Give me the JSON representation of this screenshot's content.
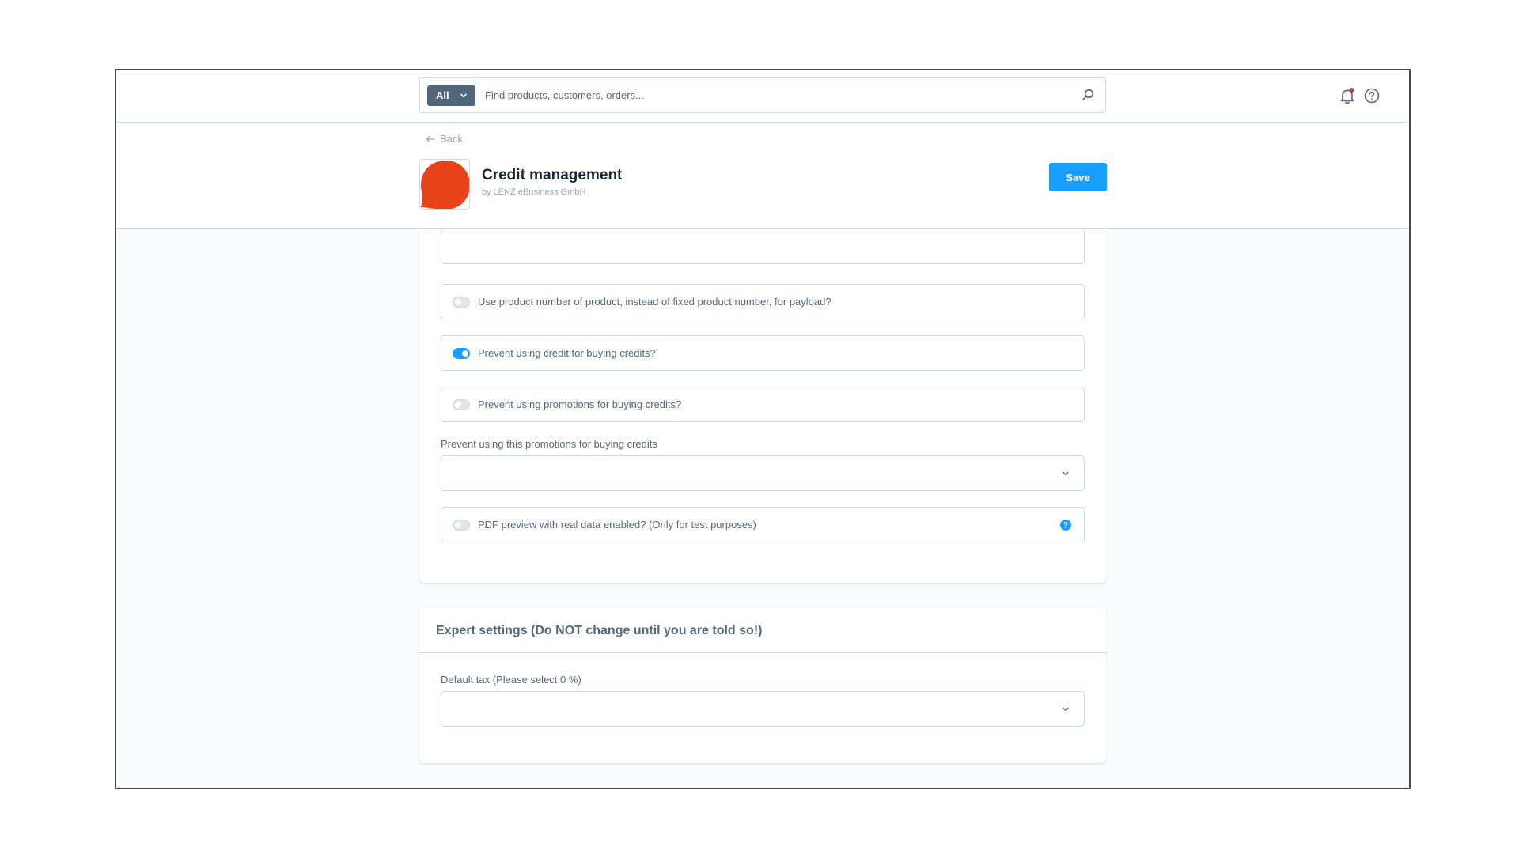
{
  "topbar": {
    "search": {
      "type_label": "All",
      "placeholder": "Find products, customers, orders...",
      "value": ""
    },
    "icons": [
      "bell-icon",
      "help-icon"
    ],
    "notification_dot_color": "#de294c"
  },
  "header": {
    "back_label": "Back",
    "app_title": "Credit management",
    "app_vendor": "by LENZ eBusiness GmbH",
    "save_label": "Save",
    "logo_color": "#e8421b"
  },
  "settings": {
    "toggles": [
      {
        "label": "Use product number of product, instead of fixed product number, for payload?",
        "enabled": false
      },
      {
        "label": "Prevent using credit for buying credits?",
        "enabled": true
      },
      {
        "label": "Prevent using promotions for buying credits?",
        "enabled": false
      }
    ],
    "promotions_select": {
      "label": "Prevent using this promotions for buying credits",
      "value": ""
    },
    "pdf_toggle": {
      "label": "PDF preview with real data enabled? (Only for test purposes)",
      "enabled": false
    }
  },
  "expert": {
    "title": "Expert settings (Do NOT change until you are told so!)",
    "tax_select": {
      "label": "Default tax (Please select 0 %)",
      "value": ""
    }
  },
  "colors": {
    "accent": "#189eff",
    "text": "#52667a",
    "border": "#d1d9e0"
  }
}
